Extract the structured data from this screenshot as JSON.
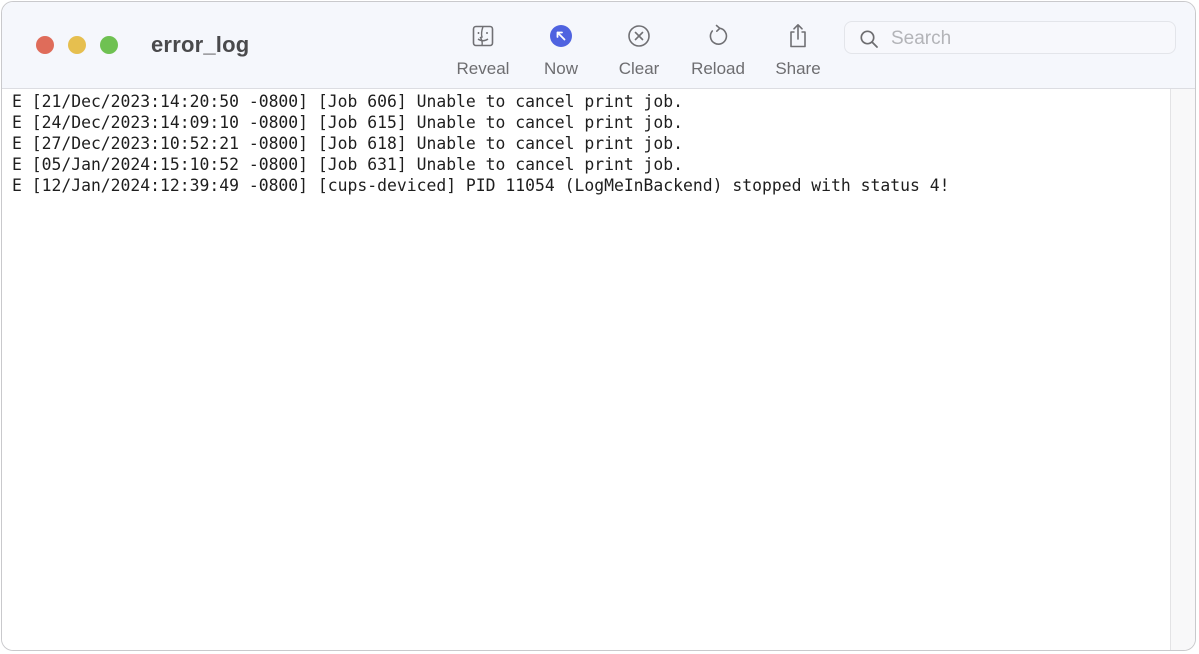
{
  "window": {
    "title": "error_log",
    "traffic_lights": {
      "close_color": "#df6c5a",
      "minimize_color": "#e6bf4f",
      "maximize_color": "#6fc152"
    }
  },
  "toolbar": {
    "buttons": [
      {
        "label": "Reveal",
        "icon": "finder-icon"
      },
      {
        "label": "Now",
        "icon": "arrow-up-left-circle-icon",
        "accent": "#4f63e0"
      },
      {
        "label": "Clear",
        "icon": "x-circle-icon"
      },
      {
        "label": "Reload",
        "icon": "reload-icon"
      },
      {
        "label": "Share",
        "icon": "share-icon"
      }
    ],
    "search": {
      "placeholder": "Search",
      "value": ""
    }
  },
  "log": {
    "lines": [
      "E [21/Dec/2023:14:20:50 -0800] [Job 606] Unable to cancel print job.",
      "E [24/Dec/2023:14:09:10 -0800] [Job 615] Unable to cancel print job.",
      "E [27/Dec/2023:10:52:21 -0800] [Job 618] Unable to cancel print job.",
      "E [05/Jan/2024:15:10:52 -0800] [Job 631] Unable to cancel print job.",
      "E [12/Jan/2024:12:39:49 -0800] [cups-deviced] PID 11054 (LogMeInBackend) stopped with status 4!"
    ]
  }
}
